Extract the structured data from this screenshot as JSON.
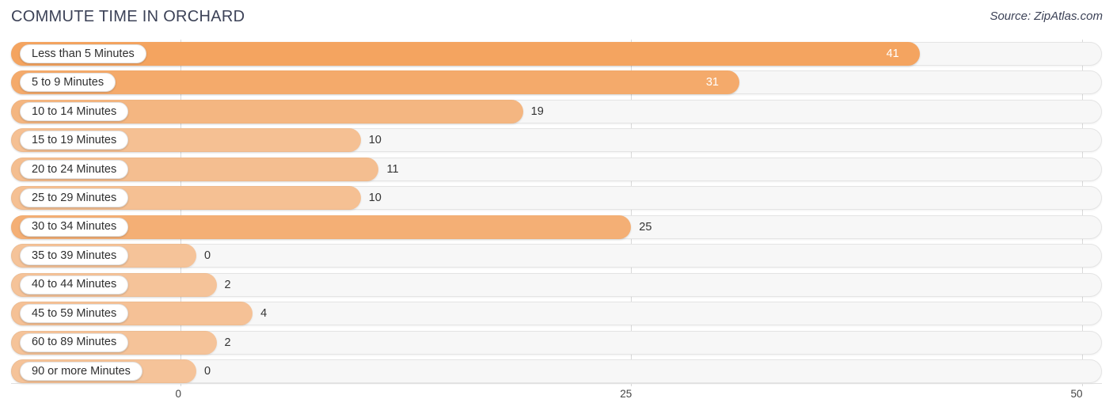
{
  "header": {
    "title": "COMMUTE TIME IN ORCHARD",
    "source": "Source: ZipAtlas.com"
  },
  "chart_data": {
    "type": "bar",
    "orientation": "horizontal",
    "title": "COMMUTE TIME IN ORCHARD",
    "xlabel": "",
    "ylabel": "",
    "xlim": [
      0,
      50
    ],
    "ticks": [
      "0",
      "25",
      "50"
    ],
    "tick_values": [
      0,
      25,
      50
    ],
    "grid": true,
    "legend": false,
    "bar_color": "#f4a460",
    "categories": [
      "Less than 5 Minutes",
      "5 to 9 Minutes",
      "10 to 14 Minutes",
      "15 to 19 Minutes",
      "20 to 24 Minutes",
      "25 to 29 Minutes",
      "30 to 34 Minutes",
      "35 to 39 Minutes",
      "40 to 44 Minutes",
      "45 to 59 Minutes",
      "60 to 89 Minutes",
      "90 or more Minutes"
    ],
    "values": [
      41,
      31,
      19,
      10,
      11,
      10,
      25,
      0,
      2,
      4,
      2,
      0
    ],
    "labels": [
      "41",
      "31",
      "19",
      "10",
      "11",
      "10",
      "25",
      "0",
      "2",
      "4",
      "2",
      "0"
    ]
  },
  "rows": [
    {
      "label": "Less than 5 Minutes",
      "value": 41,
      "display": "41",
      "inside": true,
      "opacity": 1.0
    },
    {
      "label": "5 to 9 Minutes",
      "value": 31,
      "display": "31",
      "inside": true,
      "opacity": 0.92
    },
    {
      "label": "10 to 14 Minutes",
      "value": 19,
      "display": "19",
      "inside": false,
      "opacity": 0.78
    },
    {
      "label": "15 to 19 Minutes",
      "value": 10,
      "display": "10",
      "inside": false,
      "opacity": 0.66
    },
    {
      "label": "20 to 24 Minutes",
      "value": 11,
      "display": "11",
      "inside": false,
      "opacity": 0.68
    },
    {
      "label": "25 to 29 Minutes",
      "value": 10,
      "display": "10",
      "inside": false,
      "opacity": 0.66
    },
    {
      "label": "30 to 34 Minutes",
      "value": 25,
      "display": "25",
      "inside": false,
      "opacity": 0.86
    },
    {
      "label": "35 to 39 Minutes",
      "value": 0,
      "display": "0",
      "inside": false,
      "opacity": 0.62
    },
    {
      "label": "40 to 44 Minutes",
      "value": 2,
      "display": "2",
      "inside": false,
      "opacity": 0.62
    },
    {
      "label": "45 to 59 Minutes",
      "value": 4,
      "display": "4",
      "inside": false,
      "opacity": 0.64
    },
    {
      "label": "60 to 89 Minutes",
      "value": 2,
      "display": "2",
      "inside": false,
      "opacity": 0.62
    },
    {
      "label": "90 or more Minutes",
      "value": 0,
      "display": "0",
      "inside": false,
      "opacity": 0.62
    }
  ],
  "axis": {
    "ticks": [
      "0",
      "25",
      "50"
    ]
  }
}
